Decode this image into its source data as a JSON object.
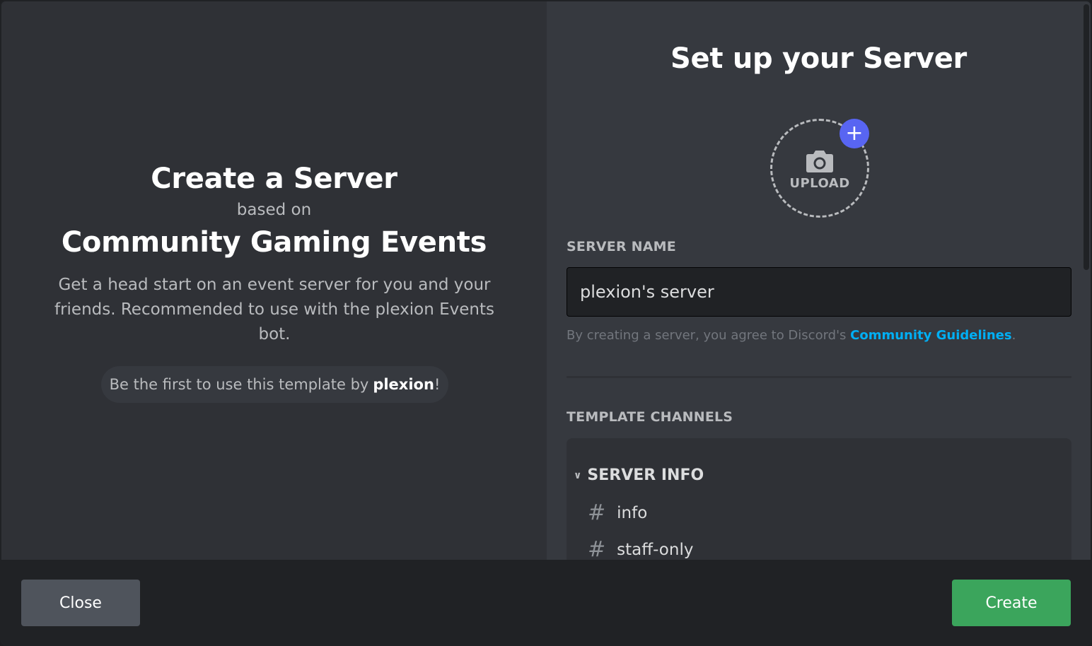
{
  "left": {
    "title": "Create a Server",
    "subtitle": "based on",
    "template_name": "Community Gaming Events",
    "description": "Get a head start on an event server for you and your friends. Recommended to use with the plexion Events bot.",
    "usage_prefix": "Be the first to use this template by",
    "usage_author": "plexion",
    "usage_suffix": "!"
  },
  "right": {
    "title": "Set up your Server",
    "upload_label": "UPLOAD",
    "upload_plus": "+",
    "server_name_label": "SERVER NAME",
    "server_name_value": "plexion's server",
    "agree_prefix": "By creating a server, you agree to Discord's",
    "agree_link": "Community Guidelines",
    "agree_suffix": ".",
    "template_channels_label": "TEMPLATE CHANNELS",
    "categories": [
      {
        "name": "SERVER INFO",
        "channels": [
          "info",
          "staff-only"
        ]
      }
    ]
  },
  "footer": {
    "close_label": "Close",
    "create_label": "Create"
  },
  "colors": {
    "accent": "#5865f2",
    "create": "#3ba55c",
    "link": "#00aff4"
  }
}
